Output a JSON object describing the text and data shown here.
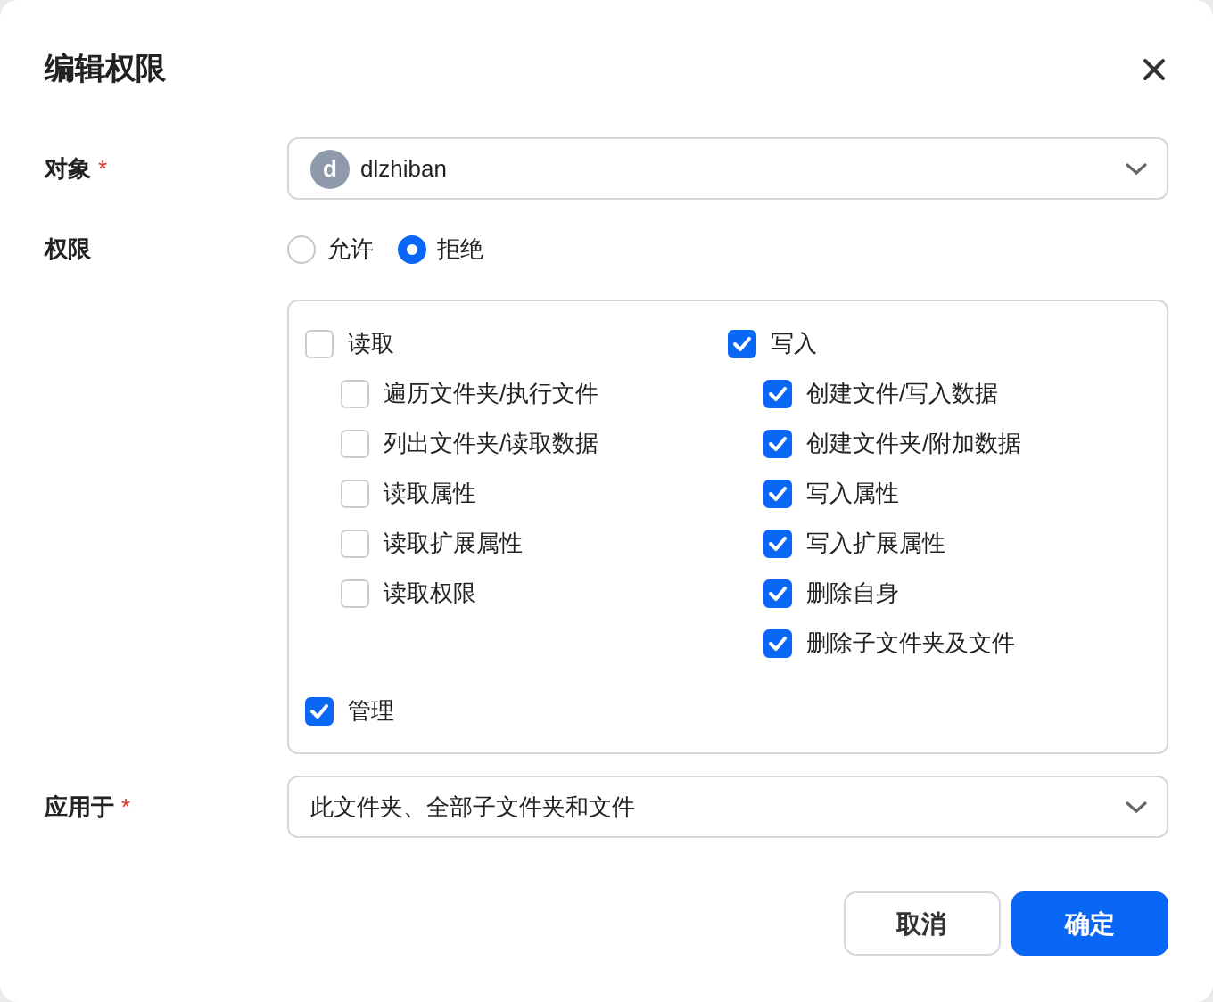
{
  "dialog": {
    "title": "编辑权限"
  },
  "object_field": {
    "label": "对象",
    "required_mark": "*",
    "avatar": "d",
    "value": "dlzhiban"
  },
  "permission_field": {
    "label": "权限",
    "options": [
      {
        "label": "允许",
        "selected": false
      },
      {
        "label": "拒绝",
        "selected": true
      }
    ]
  },
  "permission_groups": [
    {
      "label": "读取",
      "checked": false,
      "children": [
        {
          "label": "遍历文件夹/执行文件",
          "checked": false
        },
        {
          "label": "列出文件夹/读取数据",
          "checked": false
        },
        {
          "label": "读取属性",
          "checked": false
        },
        {
          "label": "读取扩展属性",
          "checked": false
        },
        {
          "label": "读取权限",
          "checked": false
        }
      ]
    },
    {
      "label": "写入",
      "checked": true,
      "children": [
        {
          "label": "创建文件/写入数据",
          "checked": true
        },
        {
          "label": "创建文件夹/附加数据",
          "checked": true
        },
        {
          "label": "写入属性",
          "checked": true
        },
        {
          "label": "写入扩展属性",
          "checked": true
        },
        {
          "label": "删除自身",
          "checked": true
        },
        {
          "label": "删除子文件夹及文件",
          "checked": true
        }
      ]
    }
  ],
  "extra_permission": {
    "label": "管理",
    "checked": true
  },
  "apply_to_field": {
    "label": "应用于",
    "required_mark": "*",
    "value": "此文件夹、全部子文件夹和文件"
  },
  "buttons": [
    {
      "label": "取消",
      "kind": "secondary"
    },
    {
      "label": "确定",
      "kind": "primary"
    }
  ]
}
